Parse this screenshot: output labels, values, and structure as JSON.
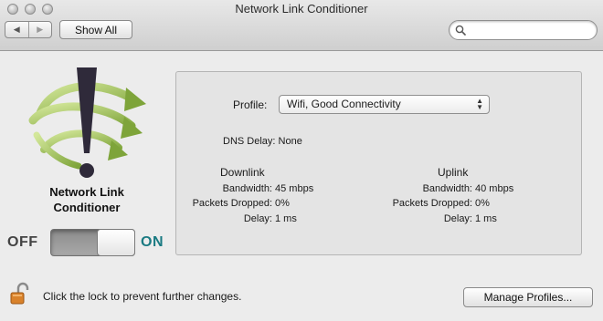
{
  "window": {
    "title": "Network Link Conditioner"
  },
  "toolbar": {
    "back_glyph": "◀",
    "forward_glyph": "▶",
    "show_all_label": "Show All",
    "search_placeholder": ""
  },
  "sidebar": {
    "logo_title_line1": "Network Link",
    "logo_title_line2": "Conditioner",
    "switch_off_label": "OFF",
    "switch_on_label": "ON",
    "switch_state": "on"
  },
  "main": {
    "profile_label": "Profile:",
    "profile_value": "Wifi, Good Connectivity",
    "dns_delay": "DNS Delay: None",
    "downlink": {
      "header": "Downlink",
      "bandwidth_label": "Bandwidth:",
      "bandwidth_value": "45 mbps",
      "packets_label": "Packets Dropped:",
      "packets_value": "0%",
      "delay_label": "Delay:",
      "delay_value": "1 ms"
    },
    "uplink": {
      "header": "Uplink",
      "bandwidth_label": "Bandwidth:",
      "bandwidth_value": "40 mbps",
      "packets_label": "Packets Dropped:",
      "packets_value": "0%",
      "delay_label": "Delay:",
      "delay_value": "1 ms"
    }
  },
  "footer": {
    "lock_text": "Click the lock to prevent further changes.",
    "manage_profiles_label": "Manage Profiles..."
  },
  "colors": {
    "accent_on": "#1a7a82",
    "arrow_green": "#8db24a",
    "exclamation": "#2f2a3a"
  },
  "icons": [
    "close-icon",
    "minimize-icon",
    "zoom-icon",
    "back-arrow-icon",
    "forward-arrow-icon",
    "search-icon",
    "network-link-conditioner-logo-icon",
    "popup-arrows-icon",
    "lock-icon"
  ]
}
